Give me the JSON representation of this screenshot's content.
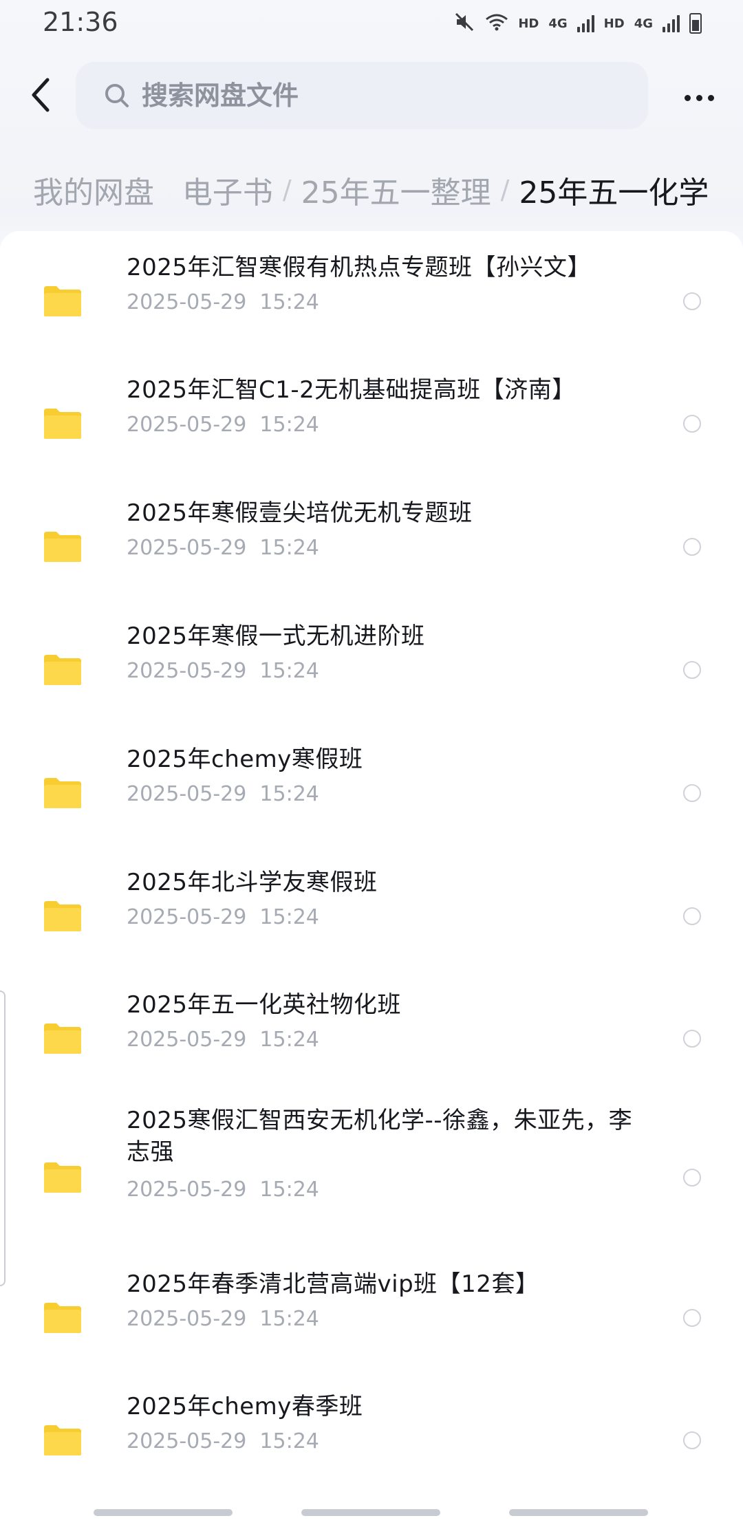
{
  "status_bar": {
    "time": "21:36",
    "hd_label_1": "HD",
    "net_label_1": "4G",
    "hd_label_2": "HD",
    "net_label_2": "4G"
  },
  "search": {
    "placeholder": "搜索网盘文件",
    "value": ""
  },
  "breadcrumb": {
    "items": [
      "我的网盘",
      "电子书",
      "25年五一整理",
      "25年五一化学"
    ]
  },
  "files": [
    {
      "name": "2025年汇智寒假有机热点专题班【孙兴文】",
      "date": "2025-05-29  15:24"
    },
    {
      "name": "2025年汇智C1-2无机基础提高班【济南】",
      "date": "2025-05-29  15:24"
    },
    {
      "name": "2025年寒假壹尖培优无机专题班",
      "date": "2025-05-29  15:24"
    },
    {
      "name": "2025年寒假一式无机进阶班",
      "date": "2025-05-29  15:24"
    },
    {
      "name": "2025年chemy寒假班",
      "date": "2025-05-29  15:24"
    },
    {
      "name": "2025年北斗学友寒假班",
      "date": "2025-05-29  15:24"
    },
    {
      "name": "2025年五一化英社物化班",
      "date": "2025-05-29  15:24"
    },
    {
      "name": "2025寒假汇智西安无机化学--徐鑫，朱亚先，李志强",
      "date": "2025-05-29  15:24"
    },
    {
      "name": "2025年春季清北营高端vip班【12套】",
      "date": "2025-05-29  15:24"
    },
    {
      "name": "2025年chemy春季班",
      "date": "2025-05-29  15:24"
    }
  ],
  "colors": {
    "folder": "#fdd84a",
    "folder_tab": "#f8cd32",
    "accent_text": "#16181e",
    "muted_text": "#a6aab3"
  },
  "icons": {
    "back": "chevron-left-icon",
    "search": "search-icon",
    "more": "more-horizontal-icon",
    "folder": "folder-icon"
  }
}
